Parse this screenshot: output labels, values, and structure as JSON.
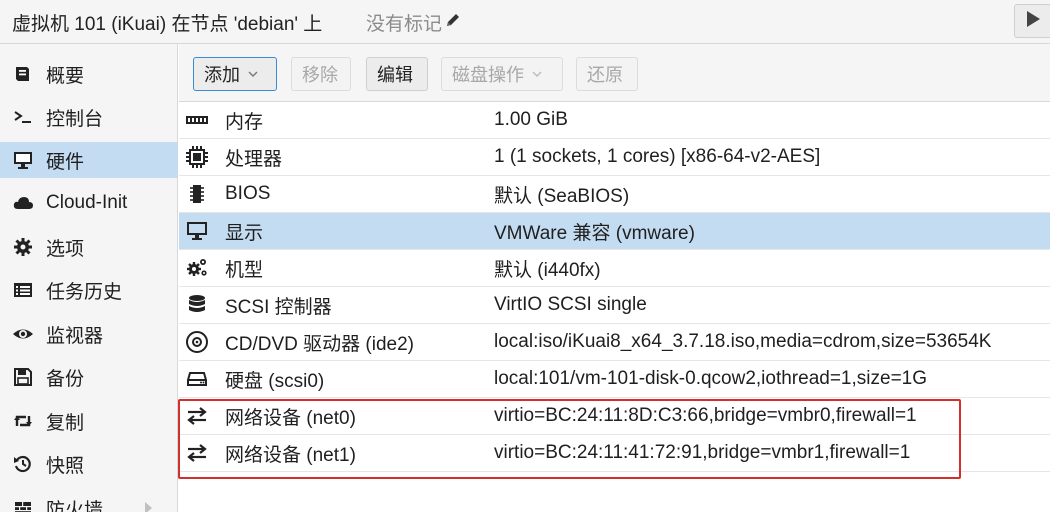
{
  "header": {
    "title": "虚拟机 101 (iKuai) 在节点 'debian' 上",
    "tags_label": "没有标记"
  },
  "sidebar": {
    "items": [
      {
        "label": "概要",
        "icon": "book-icon"
      },
      {
        "label": "控制台",
        "icon": "terminal-icon"
      },
      {
        "label": "硬件",
        "icon": "desktop-icon",
        "selected": true
      },
      {
        "label": "Cloud-Init",
        "icon": "cloud-icon"
      },
      {
        "label": "选项",
        "icon": "gear-icon"
      },
      {
        "label": "任务历史",
        "icon": "list-icon"
      },
      {
        "label": "监视器",
        "icon": "eye-icon"
      },
      {
        "label": "备份",
        "icon": "floppy-icon"
      },
      {
        "label": "复制",
        "icon": "retweet-icon"
      },
      {
        "label": "快照",
        "icon": "history-icon"
      },
      {
        "label": "防火墙",
        "icon": "shield-icon"
      }
    ]
  },
  "toolbar": {
    "add_label": "添加",
    "remove_label": "移除",
    "edit_label": "编辑",
    "disk_action_label": "磁盘操作",
    "revert_label": "还原"
  },
  "hardware": {
    "rows": [
      {
        "name": "内存",
        "value": "1.00 GiB",
        "icon": "memory-icon"
      },
      {
        "name": "处理器",
        "value": "1 (1 sockets, 1 cores) [x86-64-v2-AES]",
        "icon": "cpu-icon"
      },
      {
        "name": "BIOS",
        "value": "默认 (SeaBIOS)",
        "icon": "microchip-icon"
      },
      {
        "name": "显示",
        "value": "VMWare 兼容 (vmware)",
        "icon": "desktop-icon",
        "selected": true
      },
      {
        "name": "机型",
        "value": "默认 (i440fx)",
        "icon": "cogs-icon"
      },
      {
        "name": "SCSI 控制器",
        "value": "VirtIO SCSI single",
        "icon": "database-icon"
      },
      {
        "name": "CD/DVD 驱动器 (ide2)",
        "value": "local:iso/iKuai8_x64_3.7.18.iso,media=cdrom,size=53654K",
        "icon": "cdrom-icon"
      },
      {
        "name": "硬盘 (scsi0)",
        "value": "local:101/vm-101-disk-0.qcow2,iothread=1,size=1G",
        "icon": "hdd-icon"
      },
      {
        "name": "网络设备 (net0)",
        "value": "virtio=BC:24:11:8D:C3:66,bridge=vmbr0,firewall=1",
        "icon": "exchange-icon"
      },
      {
        "name": "网络设备 (net1)",
        "value": "virtio=BC:24:11:41:72:91,bridge=vmbr1,firewall=1",
        "icon": "exchange-icon"
      }
    ]
  },
  "colors": {
    "selection": "#c4dcf2",
    "highlight_border": "#d0312d",
    "toolbar_bg": "#f5f5f5"
  }
}
